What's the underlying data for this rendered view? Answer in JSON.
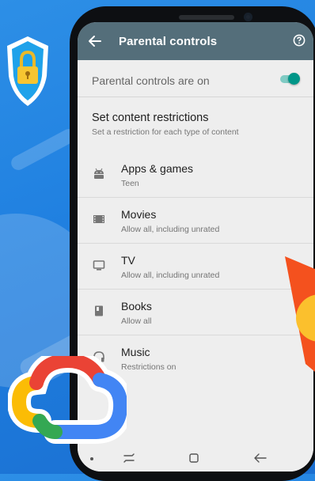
{
  "appbar": {
    "title": "Parental controls",
    "back_icon": "arrow-left-icon",
    "help_icon": "help-circle-icon"
  },
  "toggle": {
    "label": "Parental controls are on",
    "state": true,
    "accent": "#009688"
  },
  "restrictions": {
    "title": "Set content restrictions",
    "subtitle": "Set a restriction for each type of content"
  },
  "categories": [
    {
      "label": "Apps & games",
      "sub": "Teen",
      "icon": "android-icon"
    },
    {
      "label": "Movies",
      "sub": "Allow all, including unrated",
      "icon": "film-icon"
    },
    {
      "label": "TV",
      "sub": "Allow all, including unrated",
      "icon": "tv-icon"
    },
    {
      "label": "Books",
      "sub": "Allow all",
      "icon": "book-icon"
    },
    {
      "label": "Music",
      "sub": "Restrictions on",
      "icon": "headphones-icon"
    }
  ],
  "colors": {
    "appbar": "#546e7a",
    "screen_bg": "#eeeeee",
    "background": "#2d8fe6"
  }
}
